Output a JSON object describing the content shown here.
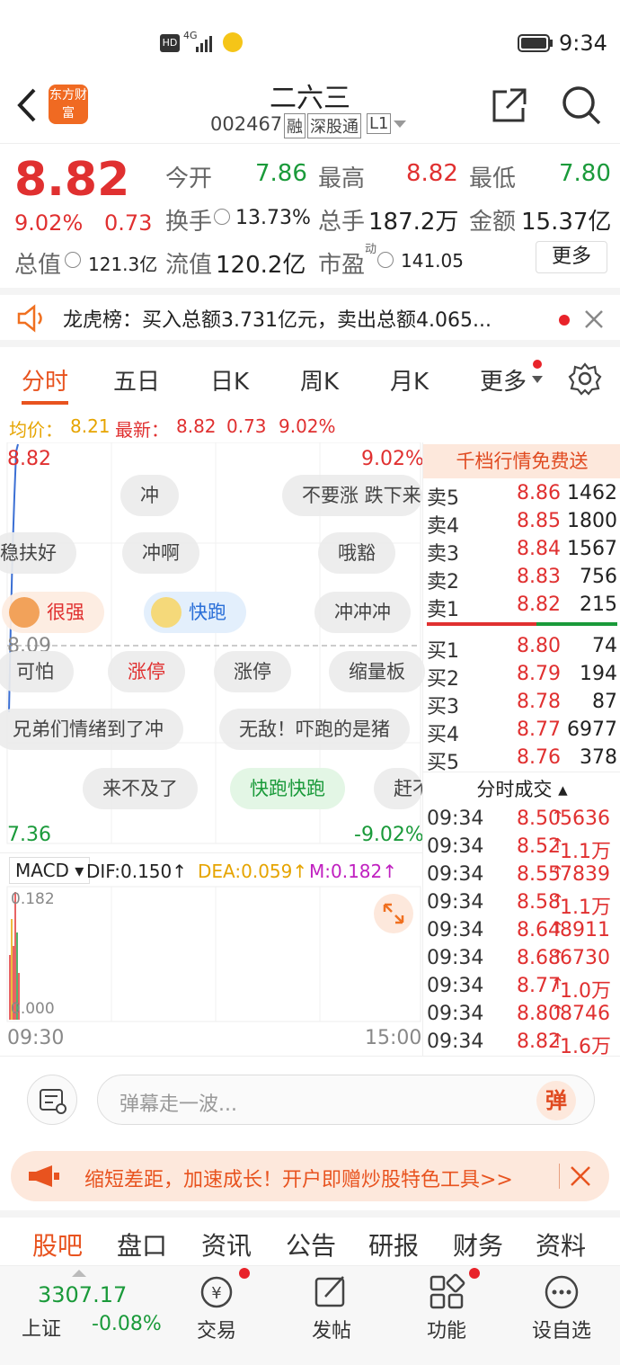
{
  "status_bar": {
    "network": "HD 4G",
    "time": "9:34"
  },
  "header": {
    "logo_text": "东方财富",
    "title": "二六三",
    "code": "002467",
    "tags": [
      "融",
      "深股通",
      "L1"
    ]
  },
  "quote": {
    "price": "8.82",
    "change_pct": "9.02%",
    "change": "0.73",
    "open_label": "今开",
    "open": "7.86",
    "high_label": "最高",
    "high": "8.82",
    "low_label": "最低",
    "low": "7.80",
    "turnover_label": "换手",
    "turnover": "13.73%",
    "volume_label": "总手",
    "volume": "187.2万",
    "amount_label": "金额",
    "amount": "15.37亿",
    "mktcap_label": "总值",
    "mktcap": "121.3亿",
    "float_label": "流值",
    "float": "120.2亿",
    "pe_label": "市盈",
    "pe_sup": "动",
    "pe": "141.05",
    "more_label": "更多"
  },
  "notice": {
    "text": "龙虎榜：买入总额3.731亿元，卖出总额4.065..."
  },
  "tabs": [
    "分时",
    "五日",
    "日K",
    "周K",
    "月K",
    "更多"
  ],
  "chart_info": {
    "avg_label": "均价：",
    "avg": "8.21",
    "latest_label": "最新：",
    "latest": "8.82",
    "change": "0.73",
    "pct": "9.02%"
  },
  "chart": {
    "top_price": "8.82",
    "top_pct": "9.02%",
    "mid_price": "8.09",
    "bottom_price": "7.36",
    "bottom_pct": "-9.02%",
    "time_start": "09:30",
    "time_end": "15:00"
  },
  "macd": {
    "label": "MACD",
    "dif": "DIF:0.150",
    "dea": "DEA:0.059",
    "m": "M:0.182",
    "top": "0.182",
    "bottom": "0.000"
  },
  "bubbles": [
    {
      "text": "冲"
    },
    {
      "text": "不要涨  跌下来"
    },
    {
      "text": "稳扶好"
    },
    {
      "text": "冲啊"
    },
    {
      "text": "哦豁"
    },
    {
      "text": "很强"
    },
    {
      "text": "快跑"
    },
    {
      "text": "冲冲冲"
    },
    {
      "text": "可怕"
    },
    {
      "text": "涨停"
    },
    {
      "text": "涨停"
    },
    {
      "text": "缩量板"
    },
    {
      "text": "兄弟们情绪到了冲"
    },
    {
      "text": "无敌！吓跑的是猪"
    },
    {
      "text": "来不及了"
    },
    {
      "text": "快跑快跑"
    },
    {
      "text": "赶不"
    }
  ],
  "orderbook": {
    "banner": "千档行情免费送",
    "asks": [
      {
        "label": "卖5",
        "price": "8.86",
        "vol": "1462"
      },
      {
        "label": "卖4",
        "price": "8.85",
        "vol": "1800"
      },
      {
        "label": "卖3",
        "price": "8.84",
        "vol": "1567"
      },
      {
        "label": "卖2",
        "price": "8.83",
        "vol": "756"
      },
      {
        "label": "卖1",
        "price": "8.82",
        "vol": "215"
      }
    ],
    "bids": [
      {
        "label": "买1",
        "price": "8.80",
        "vol": "74"
      },
      {
        "label": "买2",
        "price": "8.79",
        "vol": "194"
      },
      {
        "label": "买3",
        "price": "8.78",
        "vol": "87"
      },
      {
        "label": "买4",
        "price": "8.77",
        "vol": "6977"
      },
      {
        "label": "买5",
        "price": "8.76",
        "vol": "378"
      }
    ],
    "trades_title": "分时成交",
    "trades": [
      {
        "time": "09:34",
        "price": "8.50",
        "vol": "5636"
      },
      {
        "time": "09:34",
        "price": "8.52",
        "vol": "1.1万"
      },
      {
        "time": "09:34",
        "price": "8.55",
        "vol": "7839"
      },
      {
        "time": "09:34",
        "price": "8.58",
        "vol": "1.1万"
      },
      {
        "time": "09:34",
        "price": "8.64",
        "vol": "8911"
      },
      {
        "time": "09:34",
        "price": "8.68",
        "vol": "6730"
      },
      {
        "time": "09:34",
        "price": "8.77",
        "vol": "1.0万"
      },
      {
        "time": "09:34",
        "price": "8.80",
        "vol": "8746"
      },
      {
        "time": "09:34",
        "price": "8.82",
        "vol": "1.6万"
      }
    ]
  },
  "danmu": {
    "placeholder": "弹幕走一波...",
    "send_label": "弹"
  },
  "ad": {
    "text": "缩短差距，加速成长！开户即赠炒股特色工具>>"
  },
  "subtabs": [
    "股吧",
    "盘口",
    "资讯",
    "公告",
    "研报",
    "财务",
    "资料"
  ],
  "index": {
    "name": "上证",
    "value": "3307.17",
    "change": "-0.08%"
  },
  "bottom_nav": [
    "交易",
    "发帖",
    "功能",
    "设自选"
  ],
  "colors": {
    "up": "#e03030",
    "down": "#1a9a3a",
    "accent": "#f0701e"
  }
}
